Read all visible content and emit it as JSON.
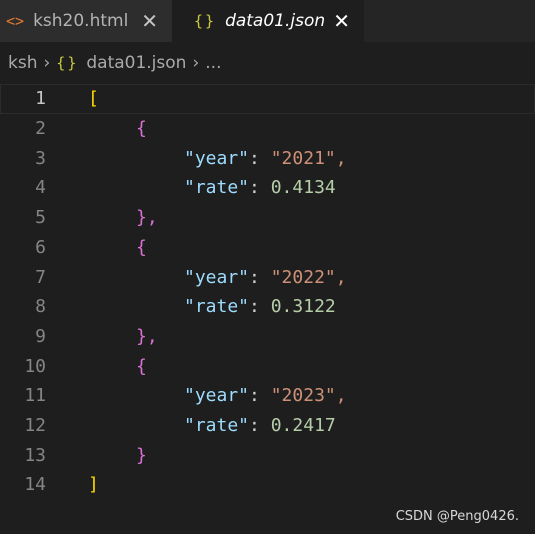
{
  "tabs": [
    {
      "icon": "html-file-icon",
      "label": "ksh20.html",
      "active": false
    },
    {
      "icon": "json-file-icon",
      "label": "data01.json",
      "active": true
    }
  ],
  "breadcrumb": {
    "folder": "ksh",
    "file": "data01.json",
    "more": "..."
  },
  "editor": {
    "current_line": 1,
    "lines": [
      {
        "number": "1",
        "text": "["
      },
      {
        "number": "2",
        "text": "{"
      },
      {
        "number": "3",
        "key": "\"year\"",
        "value": "\"2021\","
      },
      {
        "number": "4",
        "key": "\"rate\"",
        "value": "0.4134"
      },
      {
        "number": "5",
        "text": "},"
      },
      {
        "number": "6",
        "text": "{"
      },
      {
        "number": "7",
        "key": "\"year\"",
        "value": "\"2022\","
      },
      {
        "number": "8",
        "key": "\"rate\"",
        "value": "0.3122"
      },
      {
        "number": "9",
        "text": "},"
      },
      {
        "number": "10",
        "text": "{"
      },
      {
        "number": "11",
        "key": "\"year\"",
        "value": "\"2023\","
      },
      {
        "number": "12",
        "key": "\"rate\"",
        "value": "0.2417"
      },
      {
        "number": "13",
        "text": "}"
      },
      {
        "number": "14",
        "text": "]"
      }
    ]
  },
  "watermark": "CSDN @Peng0426.",
  "colors": {
    "background": "#1e1e1e",
    "bracket": "#ffd700",
    "brace": "#da70d6",
    "key": "#9cdcfe",
    "string": "#ce9178",
    "number": "#b5cea8"
  }
}
